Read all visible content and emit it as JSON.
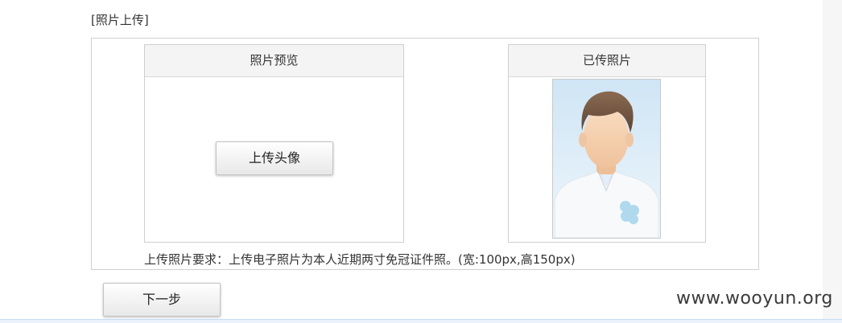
{
  "section": {
    "label": "[照片上传]"
  },
  "preview_panel": {
    "title": "照片预览",
    "upload_button_label": "上传头像"
  },
  "uploaded_panel": {
    "title": "已传照片",
    "photo_icon": "default-avatar-icon"
  },
  "requirement_text": "上传照片要求：上传电子照片为本人近期两寸免冠证件照。(宽:100px,高150px)",
  "next_button_label": "下一步",
  "watermark": "www.wooyun.org",
  "colors": {
    "panel_header_bg": "#f4f4f4",
    "border": "#cfcfcf",
    "photo_bg": "#d7eaf7"
  }
}
